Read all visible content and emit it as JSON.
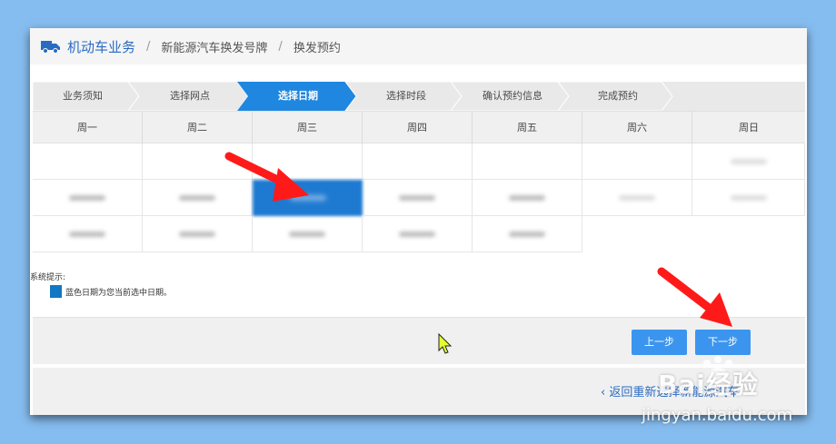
{
  "breadcrumb": {
    "root": "机动车业务",
    "item2": "新能源汽车换发号牌",
    "item3": "换发预约"
  },
  "steps": [
    "业务须知",
    "选择网点",
    "选择日期",
    "选择时段",
    "确认预约信息",
    "完成预约"
  ],
  "active_step": 2,
  "weekdays": [
    "周一",
    "周二",
    "周三",
    "周四",
    "周五",
    "周六",
    "周日"
  ],
  "tips": {
    "title": "系统提示:",
    "legend": "蓝色日期为您当前选中日期。"
  },
  "buttons": {
    "prev": "上一步",
    "next": "下一步"
  },
  "back_link": "返回重新选择新能源汽车",
  "watermark": {
    "brand": "Bai经验",
    "url": "jingyan.baidu.com"
  },
  "colors": {
    "accent": "#3b95ee",
    "active_step": "#1f87e0",
    "arrow": "#ff1a1a",
    "background": "#86bdf0"
  }
}
